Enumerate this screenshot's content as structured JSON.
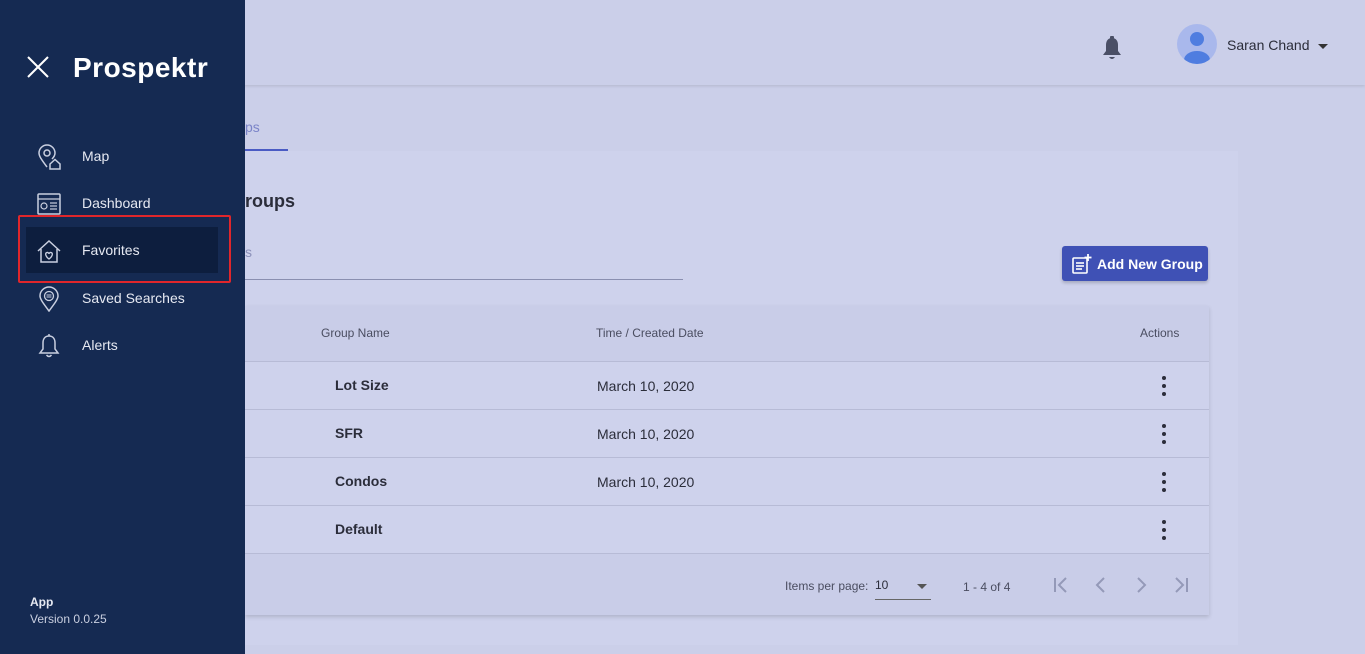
{
  "sidebar": {
    "brand": "Prospektr",
    "items": [
      {
        "label": "Map",
        "icon": "map-pin-house-icon"
      },
      {
        "label": "Dashboard",
        "icon": "dashboard-icon"
      },
      {
        "label": "Favorites",
        "icon": "house-heart-icon",
        "active": true
      },
      {
        "label": "Saved Searches",
        "icon": "saved-search-pin-icon"
      },
      {
        "label": "Alerts",
        "icon": "bell-icon"
      }
    ],
    "app_label": "App",
    "version": "Version 0.0.25"
  },
  "header": {
    "user_name": "Saran Chand",
    "notification_icon": "bell-icon"
  },
  "tabs": {
    "active_partial": "ps"
  },
  "card": {
    "title_partial": "roups",
    "search_placeholder_partial": "s",
    "add_button_label": "Add New Group"
  },
  "table": {
    "headers": {
      "group_name": "Group Name",
      "created": "Time / Created Date",
      "actions": "Actions"
    },
    "rows": [
      {
        "name": "Lot Size",
        "date": "March 10, 2020"
      },
      {
        "name": "SFR",
        "date": "March 10, 2020"
      },
      {
        "name": "Condos",
        "date": "March 10, 2020"
      },
      {
        "name": "Default",
        "date": ""
      }
    ],
    "paginator": {
      "items_per_page_label": "Items per page:",
      "items_per_page": "10",
      "range": "1 - 4 of 4"
    }
  },
  "colors": {
    "sidebar_bg": "#152a52",
    "page_bg": "#cbcfe9",
    "accent": "#3f51b5",
    "highlight": "#e0262b"
  }
}
